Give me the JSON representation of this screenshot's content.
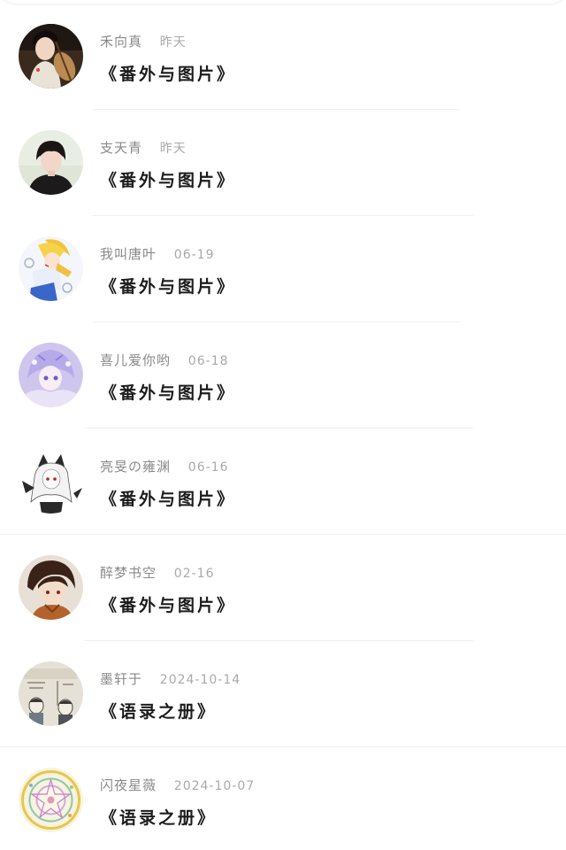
{
  "comments": [
    {
      "name": "禾向真",
      "time": "昨天",
      "book": "《番外与图片》",
      "avatar": "woman-with-pipa-avatar"
    },
    {
      "name": "支天青",
      "time": "昨天",
      "book": "《番外与图片》",
      "avatar": "woman-photo-avatar"
    },
    {
      "name": "我叫唐叶",
      "time": "06-19",
      "book": "《番外与图片》",
      "avatar": "anime-girl-blonde-avatar"
    },
    {
      "name": "喜儿爱你哟",
      "time": "06-18",
      "book": "《番外与图片》",
      "avatar": "anime-girl-purple-avatar"
    },
    {
      "name": "亮旻の雍渊",
      "time": "06-16",
      "book": "《番外与图片》",
      "avatar": "anime-catgirl-monochrome-avatar"
    },
    {
      "name": "醉梦书空",
      "time": "02-16",
      "book": "《番外与图片》",
      "avatar": "anime-boy-brown-hair-avatar"
    },
    {
      "name": "墨轩于",
      "time": "2024-10-14",
      "book": "《语录之册》",
      "avatar": "sketch-characters-avatar"
    },
    {
      "name": "闪夜星薇",
      "time": "2024-10-07",
      "book": "《语录之册》",
      "avatar": "magic-circle-avatar"
    }
  ],
  "colors": {
    "name": "#8a8a8a",
    "time": "#a9a9a9",
    "title": "#1c1c1c",
    "divider": "#f0f0f0"
  }
}
